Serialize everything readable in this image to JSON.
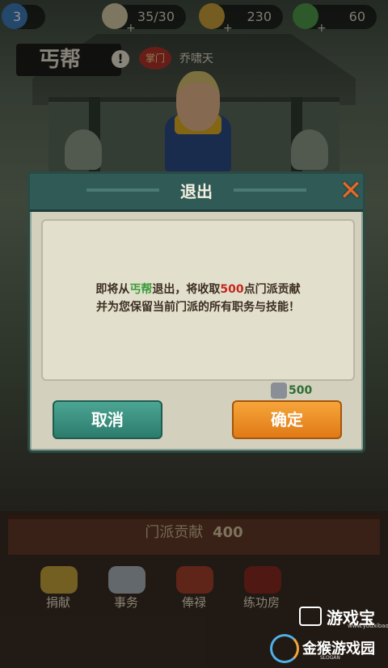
{
  "top_stats": {
    "level": "3",
    "stamina": "35/30",
    "coins": "230",
    "gems": "60"
  },
  "sect": {
    "name": "丐帮",
    "leader_badge": "掌门",
    "leader_name": "乔啸天"
  },
  "dialog": {
    "title": "退出",
    "message_line1_prefix": "即将从",
    "message_sect": "丐帮",
    "message_line1_mid": "退出，将收取",
    "message_amount": "500",
    "message_line1_suffix": "点门派贡献",
    "message_line2": "并为您保留当前门派的所有职务与技能！",
    "cost_value": "500",
    "cancel_label": "取消",
    "confirm_label": "确定"
  },
  "bottom": {
    "contribution_label": "门派贡献",
    "contribution_value": "400",
    "menu": [
      {
        "label": "捐献"
      },
      {
        "label": "事务"
      },
      {
        "label": "俸禄"
      },
      {
        "label": "练功房"
      }
    ]
  },
  "watermark": {
    "site1": "游戏宝",
    "site1_url": "www.youxibao.com",
    "site2": "金猴游戏园",
    "site2_slogan": "SLOGAN"
  },
  "colors": {
    "dialog_header": "#2f5a55",
    "cancel_button": "#3a9483",
    "confirm_button": "#ec8d22",
    "highlight_green": "#3c9b3a",
    "highlight_red": "#c4281c"
  }
}
